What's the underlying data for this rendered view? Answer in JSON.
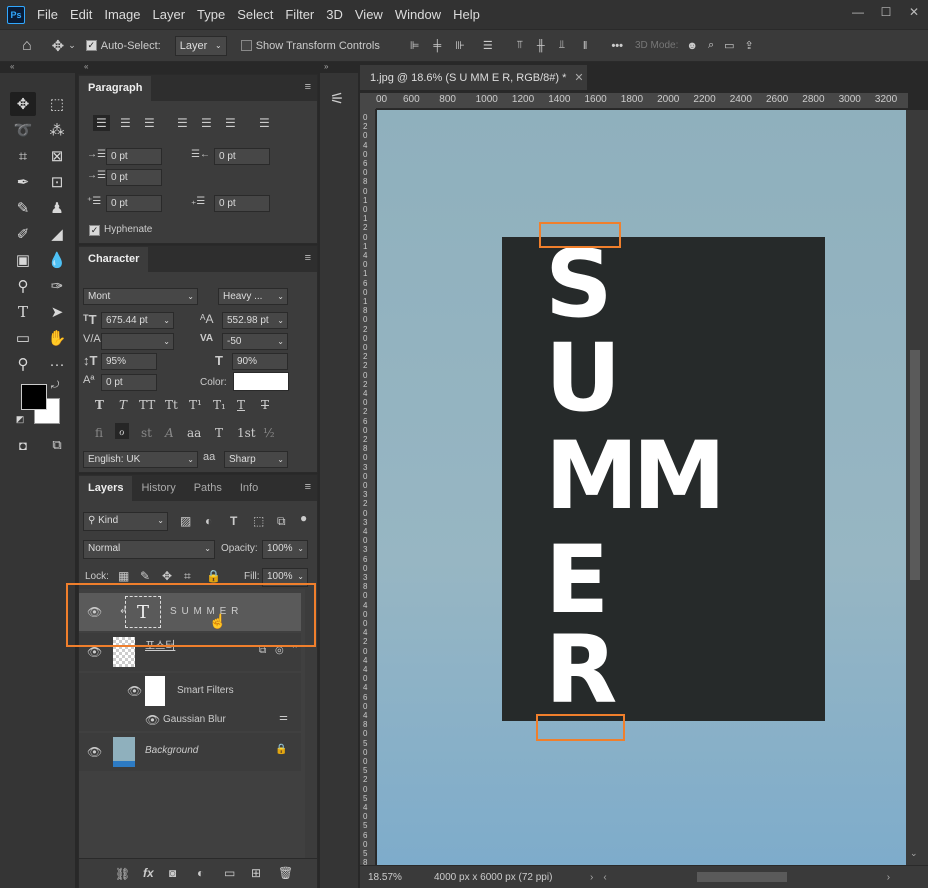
{
  "app": {
    "logo": "Ps"
  },
  "menu": [
    "File",
    "Edit",
    "Image",
    "Layer",
    "Type",
    "Select",
    "Filter",
    "3D",
    "View",
    "Window",
    "Help"
  ],
  "options": {
    "auto_select_label": "Auto-Select:",
    "auto_select_value": "Layer",
    "show_transform_label": "Show Transform Controls",
    "mode_3d_label": "3D Mode:",
    "more_label": "•••"
  },
  "paragraph": {
    "title": "Paragraph",
    "indent_left": "0 pt",
    "indent_right": "0 pt",
    "indent_first": "0 pt",
    "space_before": "0 pt",
    "space_after": "0 pt",
    "hyphenate_label": "Hyphenate"
  },
  "character": {
    "title": "Character",
    "font_family": "Mont",
    "font_style": "Heavy ...",
    "font_size": "675.44 pt",
    "leading": "552.98 pt",
    "kerning": "",
    "tracking": "-50",
    "vscale": "95%",
    "hscale": "90%",
    "baseline": "0 pt",
    "color_label": "Color:",
    "color": "#ffffff",
    "language": "English: UK",
    "aa_label": "aa",
    "antialias": "Sharp",
    "style_buttons": [
      "T",
      "T",
      "TT",
      "Tt",
      "T¹",
      "T₁",
      "T",
      "T"
    ],
    "opentype_buttons": [
      "fi",
      "ℴ",
      "st",
      "A",
      "aa",
      "T",
      "1st",
      "½"
    ]
  },
  "layers": {
    "tabs": [
      "Layers",
      "History",
      "Paths",
      "Info"
    ],
    "filter_kind": "Kind",
    "blend_mode": "Normal",
    "opacity_label": "Opacity:",
    "opacity": "100%",
    "lock_label": "Lock:",
    "fill_label": "Fill:",
    "fill": "100%",
    "items": [
      {
        "name": "S U M M E R",
        "type": "text"
      },
      {
        "name": "포스터",
        "type": "smart"
      },
      {
        "name": "Smart Filters",
        "type": "filters"
      },
      {
        "name": "Gaussian Blur",
        "type": "filter"
      },
      {
        "name": "Background",
        "type": "background"
      }
    ]
  },
  "document": {
    "tab_title": "1.jpg @ 18.6% (S U MM E R, RGB/8#) *",
    "ruler_h": [
      "00",
      "600",
      "800",
      "1000",
      "1200",
      "1400",
      "1600",
      "1800",
      "2000",
      "2200",
      "2400",
      "2600",
      "2800",
      "3000",
      "3200"
    ],
    "ruler_v": [
      "0",
      "2",
      "0",
      "4",
      "0",
      "6",
      "0",
      "8",
      "0",
      "1",
      "0",
      "1",
      "2",
      "0",
      "1",
      "4",
      "0",
      "1",
      "6",
      "0",
      "1",
      "8",
      "0",
      "2",
      "0",
      "0",
      "2",
      "2",
      "0",
      "2",
      "4",
      "0",
      "2",
      "6",
      "0",
      "2",
      "8",
      "0",
      "3",
      "0",
      "0",
      "3",
      "2",
      "0",
      "3",
      "4",
      "0",
      "3",
      "6",
      "0",
      "3",
      "8",
      "0",
      "4",
      "0",
      "0",
      "4",
      "2",
      "0",
      "4",
      "4",
      "0",
      "4",
      "6",
      "0",
      "4",
      "8",
      "0",
      "5",
      "0",
      "0",
      "5",
      "2",
      "0",
      "5",
      "4",
      "0",
      "5",
      "6",
      "0",
      "5",
      "8",
      "0"
    ],
    "letters": [
      "S",
      "U",
      "MM",
      "E",
      "R"
    ],
    "zoom": "18.57%",
    "doc_info": "4000 px x 6000 px (72 ppi)"
  },
  "colors": {
    "accent": "#f07f2c",
    "poster": "#262a2a",
    "sky": "#8fb0bd"
  }
}
